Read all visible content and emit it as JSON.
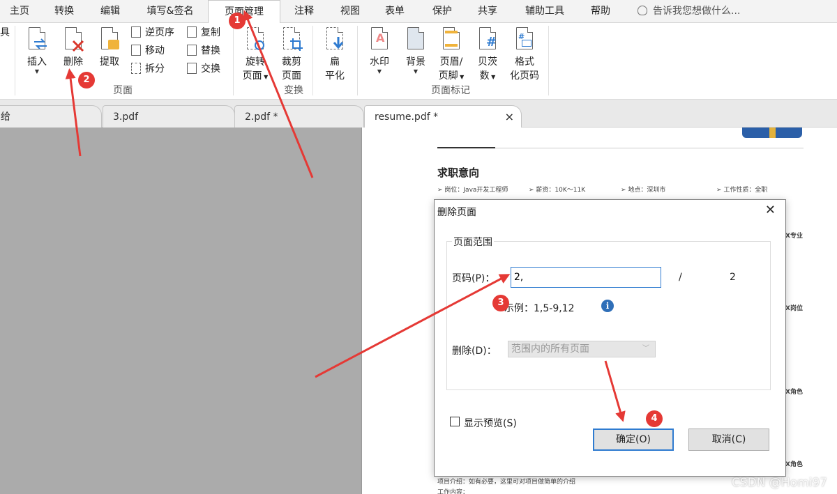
{
  "menu": {
    "items": [
      "主页",
      "转换",
      "编辑",
      "填写&签名",
      "页面管理",
      "注释",
      "视图",
      "表单",
      "保护",
      "共享",
      "辅助工具",
      "帮助"
    ],
    "active": "页面管理",
    "tell_me": "告诉我您想做什么..."
  },
  "ribbon": {
    "left_cut": "具",
    "insert": "插入",
    "delete": "删除",
    "extract": "提取",
    "reverse": "逆页序",
    "move": "移动",
    "split": "拆分",
    "copy": "复制",
    "replace": "替换",
    "swap": "交换",
    "group_pages": "页面",
    "rotate_1": "旋转",
    "rotate_2": "页面",
    "crop_1": "裁剪",
    "crop_2": "页面",
    "flatten_1": "扁",
    "flatten_2": "平化",
    "group_transform": "变换",
    "watermark": "水印",
    "background": "背景",
    "header_1": "页眉/",
    "header_2": "页脚",
    "bates_1": "贝茨",
    "bates_2": "数",
    "format_1": "格式",
    "format_2": "化页码",
    "group_marks": "页面标记"
  },
  "tabs": {
    "first_cut": "给",
    "tab2": "3.pdf",
    "tab3": "2.pdf *",
    "tab4": "resume.pdf *",
    "close": "×"
  },
  "page": {
    "heading": "求职意向",
    "meta": [
      "➢ 岗位：Java开发工程师",
      "➢ 薪资：10K～11K",
      "➢ 地点：深圳市",
      "➢ 工作性质：全职"
    ],
    "side": [
      "X专业",
      "X岗位",
      "X角色",
      "X角色"
    ],
    "bottom1": "项目介绍：如有必要，这里可对项目做简单的介绍",
    "bottom2": "工作内容："
  },
  "dialog": {
    "title": "删除页面",
    "close": "✕",
    "group_label": "页面范围",
    "page_label": "页码(P)：",
    "page_value": "2,",
    "slash": "/",
    "total": "2",
    "example": "示例：1,5-9,12",
    "delete_label": "删除(D)：",
    "delete_option": "范围内的所有页面",
    "preview": "显示预览(S)",
    "ok": "确定(O)",
    "cancel": "取消(C)"
  },
  "annotations": {
    "markers": [
      "1",
      "2",
      "3",
      "4"
    ],
    "color": "#e53935"
  },
  "watermark": "CSDN @Homi97"
}
